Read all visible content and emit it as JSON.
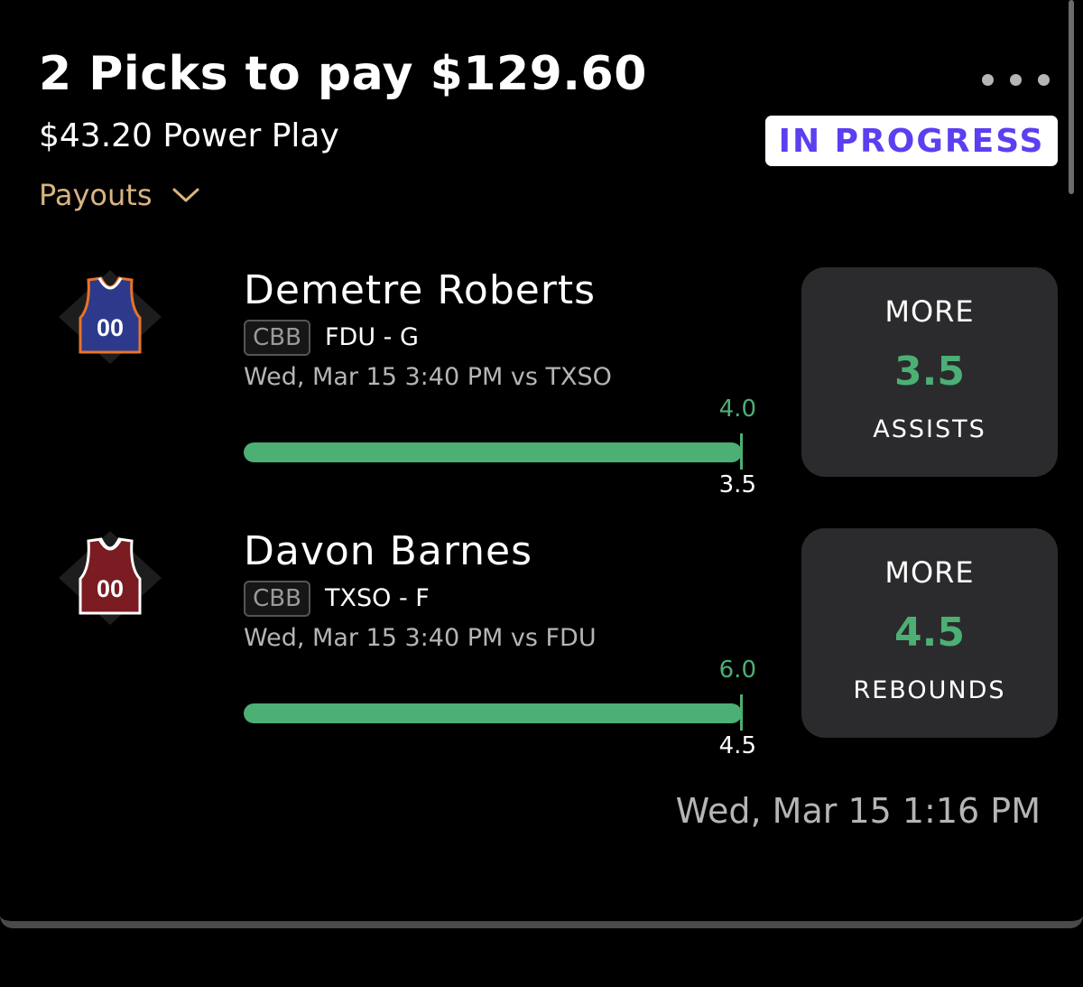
{
  "entry": {
    "title": "2 Picks to pay $129.60",
    "subtitle": "$43.20 Power Play",
    "payouts_label": "Payouts",
    "status": "IN PROGRESS",
    "timestamp": "Wed, Mar 15 1:16 PM"
  },
  "picks": [
    {
      "player_name": "Demetre Roberts",
      "league": "CBB",
      "team_pos": "FDU - G",
      "game_time": "Wed, Mar 15 3:40 PM  vs TXSO",
      "jersey_number": "00",
      "jersey_color": "#2d3a8c",
      "jersey_trim": "#e9732b",
      "current_value": "4.0",
      "line_value": "3.5",
      "progress_fraction": 1.0,
      "direction": "MORE",
      "line": "3.5",
      "stat": "ASSISTS"
    },
    {
      "player_name": "Davon Barnes",
      "league": "CBB",
      "team_pos": "TXSO - F",
      "game_time": "Wed, Mar 15 3:40 PM  vs FDU",
      "jersey_number": "00",
      "jersey_color": "#7a1c22",
      "jersey_trim": "#ffffff",
      "current_value": "6.0",
      "line_value": "4.5",
      "progress_fraction": 1.0,
      "direction": "MORE",
      "line": "4.5",
      "stat": "REBOUNDS"
    }
  ],
  "colors": {
    "accent_green": "#4caf74",
    "status_purple": "#5b3ff0",
    "payouts_gold": "#d9b383",
    "muted_text": "#b5b5b5"
  },
  "icons": {
    "more": "more-horizontal-icon",
    "payouts": "chevron-down-icon",
    "jersey": "jersey-icon"
  }
}
